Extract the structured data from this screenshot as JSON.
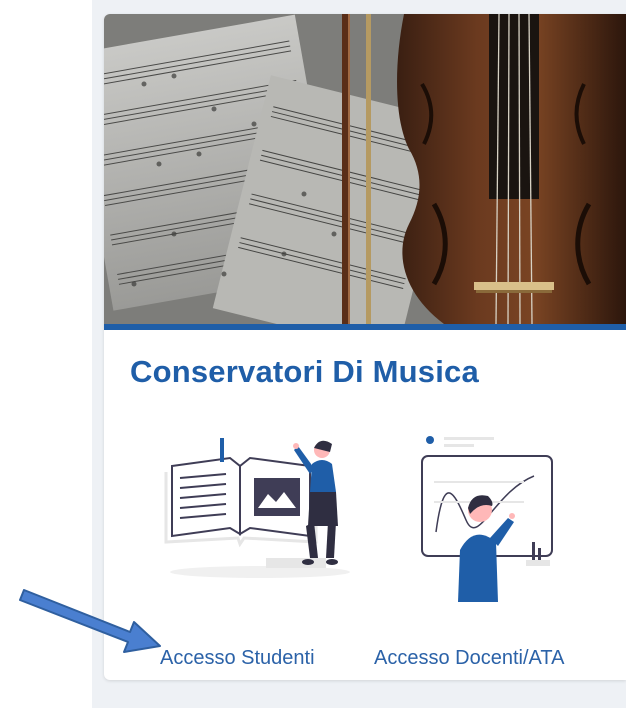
{
  "card": {
    "title": "Conservatori Di Musica",
    "links": [
      {
        "label": "Accesso Studenti"
      },
      {
        "label": "Accesso Docenti/ATA"
      }
    ]
  },
  "colors": {
    "accent": "#1f5ea8",
    "link": "#2b62a8",
    "arrow": "#4a7fd0",
    "page_bg": "#eef1f5"
  },
  "icons": [
    "violin-sheet-music-image",
    "student-reading-book-illustration",
    "teacher-whiteboard-illustration",
    "pointer-arrow-icon"
  ]
}
